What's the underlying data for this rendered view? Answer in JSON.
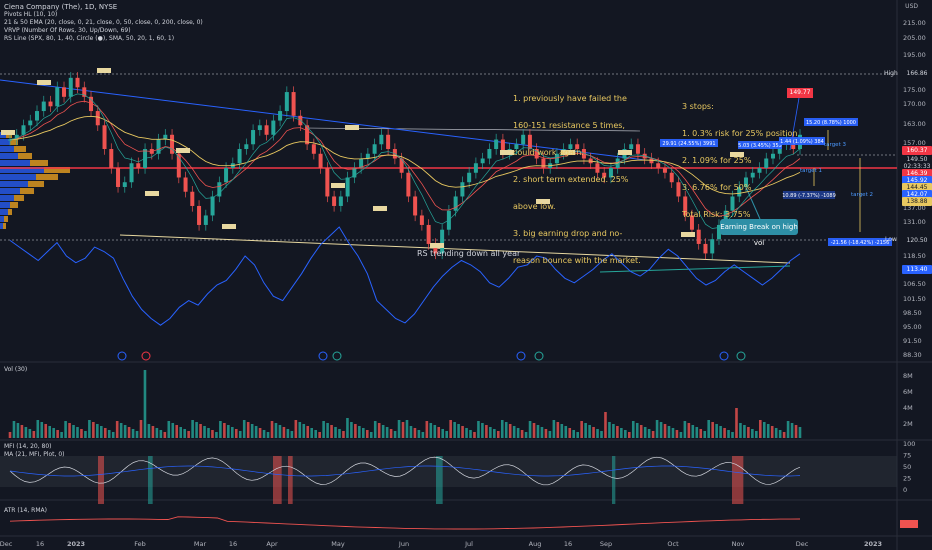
{
  "header": {
    "title": "Ciena Company (The), 1D, NYSE",
    "indicators": [
      "Pivots HL (10, 10)",
      "21 & 50 EMA (20, close, 0, 21, close, 0, 50, close, 0, 200, close, 0)",
      "VRVP (Number Of Rows, 30, Up/Down, 69)",
      "RS Line (SPX, 80, 1, 40, Circle (●), SMA, 50, 20, 1, 60, 1)"
    ]
  },
  "currency": "USD",
  "notes": {
    "resistance": [
      "1. previously have failed the",
      "160-151 resistance 5 times,",
      "could work again.",
      "2. short term extended. 25%",
      "above low.",
      "3. big earning drop and no-",
      "reason bounce with the market."
    ],
    "stops": [
      "3 stops:",
      "1. 0.3% risk for 25% position",
      "2. 1.09% for 25%",
      "3. 6.76% for 50%",
      "Total Risk: 3.75%"
    ],
    "callout": "Earning Break on high vol",
    "rs_trend": "RS trending down all year",
    "high_label": "High",
    "low_label": "Low",
    "target_labels": [
      "target 1",
      "target 2",
      "target 3"
    ],
    "measure_boxes": [
      "29.91 (24.55%) 3991",
      "5.03 (3.45%) 355",
      "1.44 (1.09%) 384",
      "10.89 (-7.37%) -1089",
      "-21.56 (-18.42%) -2156",
      "15.20 (8.78%) 1000"
    ],
    "current_price_box": "149.77"
  },
  "panes": {
    "vol_label": "Vol (30)",
    "mfi_label": "MFI (14, 20, 80)",
    "ma_label": "MA (21, MFI, Plot, 0)",
    "atr_label": "ATR (14, RMA)"
  },
  "price_labels": [
    {
      "text": "166.86",
      "color": "#131722",
      "fg": "#d1d4dc"
    },
    {
      "text": "160.37",
      "color": "#f23645",
      "fg": "#ffffff"
    },
    {
      "text": "149.50",
      "color": "#131722",
      "fg": "#d1d4dc"
    },
    {
      "text": "02:33:33",
      "color": "#131722",
      "fg": "#d1d4dc"
    },
    {
      "text": "146.39",
      "color": "#f23645",
      "fg": "#ffffff"
    },
    {
      "text": "145.92",
      "color": "#2962ff",
      "fg": "#ffffff"
    },
    {
      "text": "144.45",
      "color": "#e8c860",
      "fg": "#131722"
    },
    {
      "text": "142.07",
      "color": "#2962ff",
      "fg": "#ffffff"
    },
    {
      "text": "138.88",
      "color": "#e8c860",
      "fg": "#131722"
    },
    {
      "text": "120.50",
      "color": "#131722",
      "fg": "#d1d4dc"
    },
    {
      "text": "113.40",
      "color": "#2962ff",
      "fg": "#ffffff"
    }
  ],
  "chart_data": {
    "type": "line",
    "title": "Ciena Company (The), 1D, NYSE",
    "x_ticks": [
      "Dec",
      "16",
      "2023",
      "Feb",
      "Mar",
      "16",
      "Apr",
      "May",
      "Jun",
      "Jul",
      "Aug",
      "16",
      "Sep",
      "Oct",
      "Nov",
      "Dec",
      "2023"
    ],
    "price_axis_ticks": [
      215.0,
      205.0,
      195.0,
      185.0,
      175.0,
      170.0,
      163.0,
      157.0,
      151.0,
      144.0,
      137.0,
      131.0,
      124.5,
      118.5,
      112.5,
      106.5,
      101.5,
      98.5,
      95.0,
      91.5,
      88.3
    ],
    "volume_axis_ticks": [
      "8M",
      "6M",
      "4M",
      "2M"
    ],
    "mfi_axis_ticks": [
      100,
      75,
      50,
      25,
      0
    ],
    "price_close": [
      152,
      153,
      155,
      156,
      158,
      160,
      159,
      163,
      161,
      165,
      163,
      161,
      158,
      155,
      150,
      146,
      142,
      143,
      147,
      146,
      150,
      149,
      152,
      153,
      149,
      144,
      141,
      138,
      134,
      136,
      140,
      143,
      146,
      147,
      150,
      151,
      154,
      155,
      153,
      156,
      158,
      162,
      157,
      155,
      151,
      149,
      146,
      140,
      138,
      140,
      144,
      146,
      148,
      149,
      151,
      153,
      150,
      148,
      145,
      140,
      136,
      134,
      130,
      128,
      133,
      137,
      140,
      143,
      145,
      147,
      148,
      150,
      152,
      149,
      150,
      151,
      153,
      150,
      148,
      146,
      147,
      149,
      150,
      151,
      150,
      148,
      147,
      145,
      144,
      146,
      148,
      150,
      151,
      149,
      148,
      147,
      146,
      145,
      143,
      140,
      136,
      133,
      130,
      128,
      131,
      134,
      137,
      140,
      142,
      144,
      145,
      146,
      148,
      149,
      151,
      152,
      150,
      153
    ],
    "rs_line": [
      116.5,
      115.0,
      113.5,
      112.0,
      114.0,
      116.0,
      113.0,
      111.5,
      112.5,
      115.0,
      114.0,
      112.5,
      108.0,
      104.0,
      101.0,
      99.0,
      97.5,
      99.0,
      101.5,
      103.0,
      102.0,
      104.5,
      106.5,
      107.5,
      110.0,
      113.0,
      111.0,
      107.0,
      104.0,
      103.0,
      106.0,
      109.0,
      112.5,
      115.5,
      117.5,
      119.5,
      116.0,
      113.0,
      109.0,
      103.0,
      101.0,
      99.0,
      98.0,
      100.0,
      103.0,
      106.0,
      108.5,
      110.5,
      112.0,
      111.0,
      109.5,
      107.0,
      106.0,
      108.0,
      110.5,
      111.0,
      113.0,
      112.5,
      110.0,
      108.0,
      107.0,
      108.5,
      110.0,
      112.0,
      113.5,
      111.5,
      109.5,
      108.5,
      110.0,
      112.5,
      114.5,
      113.0,
      110.5,
      108.0,
      106.5,
      107.5,
      109.5,
      111.0,
      109.5,
      108.0,
      106.5,
      108.0,
      110.0,
      112.0,
      113.5
    ],
    "levels": {
      "high": 166.86,
      "low": 120.5,
      "current": 149.5,
      "target_box": 149.77
    }
  }
}
